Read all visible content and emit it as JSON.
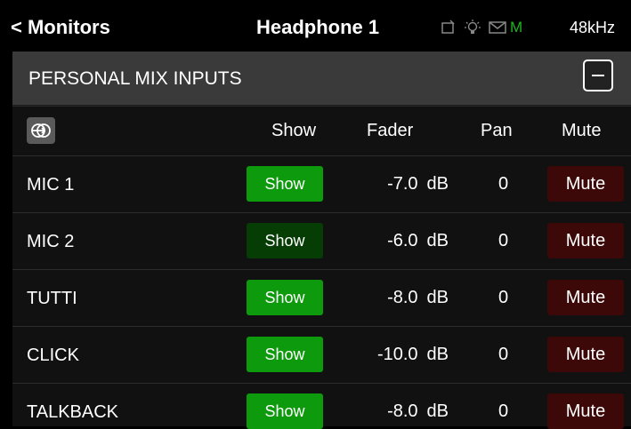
{
  "topbar": {
    "back_label": "< Monitors",
    "title": "Headphone 1",
    "status_letter": "M",
    "sample_rate": "48kHz",
    "icons": [
      "device-icon",
      "bulb-icon",
      "mail-icon"
    ]
  },
  "section": {
    "title": "PERSONAL MIX INPUTS",
    "collapse_icon": "minus-icon"
  },
  "columns": {
    "link_icon": "link-channels-icon",
    "show": "Show",
    "fader": "Fader",
    "pan": "Pan",
    "mute": "Mute"
  },
  "rows": [
    {
      "name": "MIC 1",
      "show_label": "Show",
      "show_on": true,
      "fader_value": "-7.0",
      "fader_unit": "dB",
      "pan": "0",
      "mute_label": "Mute"
    },
    {
      "name": "MIC 2",
      "show_label": "Show",
      "show_on": false,
      "fader_value": "-6.0",
      "fader_unit": "dB",
      "pan": "0",
      "mute_label": "Mute"
    },
    {
      "name": "TUTTI",
      "show_label": "Show",
      "show_on": true,
      "fader_value": "-8.0",
      "fader_unit": "dB",
      "pan": "0",
      "mute_label": "Mute"
    },
    {
      "name": "CLICK",
      "show_label": "Show",
      "show_on": true,
      "fader_value": "-10.0",
      "fader_unit": "dB",
      "pan": "0",
      "mute_label": "Mute"
    },
    {
      "name": "TALKBACK",
      "show_label": "Show",
      "show_on": true,
      "fader_value": "-8.0",
      "fader_unit": "dB",
      "pan": "0",
      "mute_label": "Mute"
    }
  ],
  "colors": {
    "show_on": "#0d9a0d",
    "show_off": "#053d05",
    "mute": "#3d0808",
    "status_green": "#1db51d"
  }
}
